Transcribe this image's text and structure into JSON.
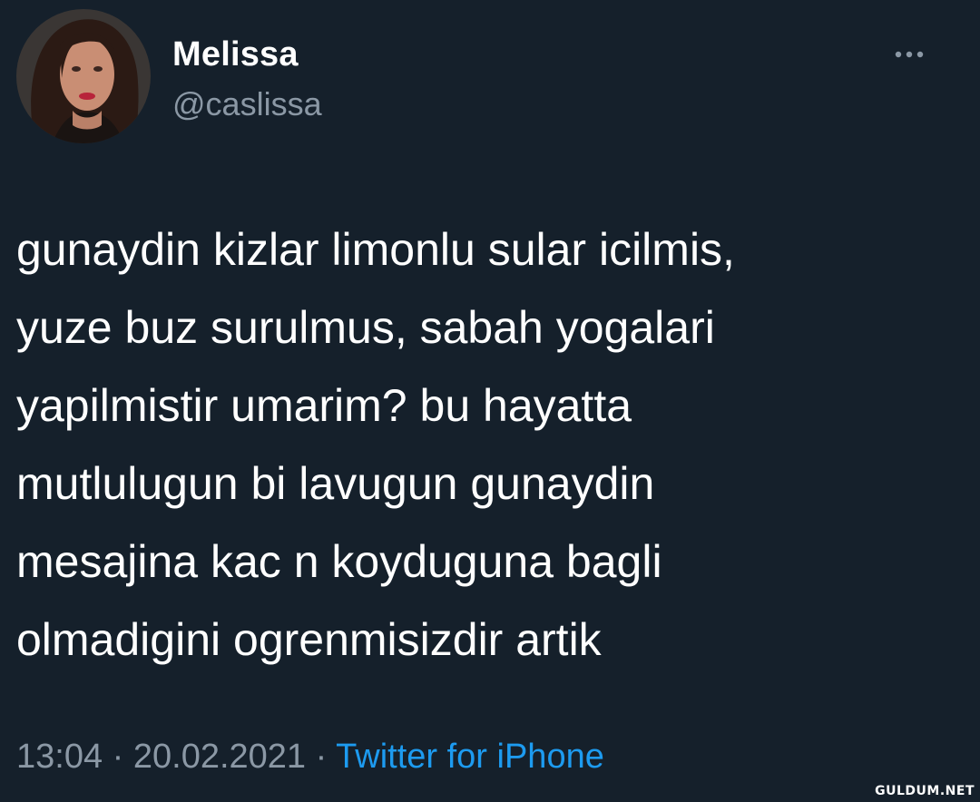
{
  "tweet": {
    "display_name": "Melissa",
    "handle": "@caslissa",
    "more_icon": "more-horizontal-icon",
    "text_lines": [
      "gunaydin kizlar limonlu sular icilmis,",
      "yuze buz surulmus, sabah yogalari",
      "yapilmistir umarim? bu hayatta",
      "mutlulugun bi lavugun gunaydin",
      "mesajina kac n koyduguna bagli",
      "olmadigini ogrenmisizdir artik"
    ],
    "time": "13:04",
    "date": "20.02.2021",
    "separator": "·",
    "source": "Twitter for iPhone"
  },
  "watermark": "GULDUM.NET",
  "colors": {
    "background": "#15202b",
    "text": "#ffffff",
    "secondary_text": "#8b98a5",
    "link": "#1d9bf0"
  }
}
